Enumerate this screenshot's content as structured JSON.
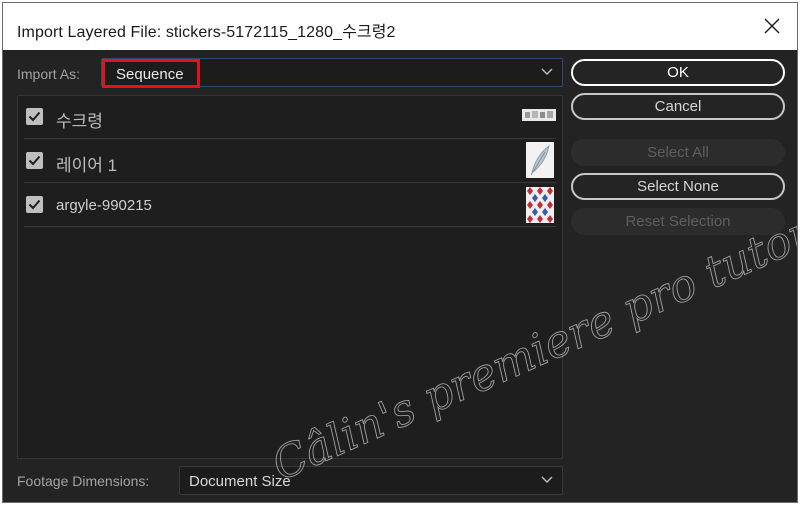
{
  "window": {
    "title": "Import Layered File: stickers-5172115_1280_수크령2"
  },
  "import_as": {
    "label": "Import As:",
    "value": "Sequence"
  },
  "layers": [
    {
      "name": "수크령",
      "checked": true
    },
    {
      "name": "레이어 1",
      "checked": true
    },
    {
      "name": "argyle-990215",
      "checked": true
    }
  ],
  "buttons": {
    "ok": "OK",
    "cancel": "Cancel",
    "select_all": "Select All",
    "select_none": "Select None",
    "reset_selection": "Reset Selection"
  },
  "footage_dimensions": {
    "label": "Footage Dimensions:",
    "value": "Document Size"
  },
  "watermark": "Câlin's premiere pro tutorials",
  "colors": {
    "highlight": "#e2141b",
    "background": "#232323"
  }
}
